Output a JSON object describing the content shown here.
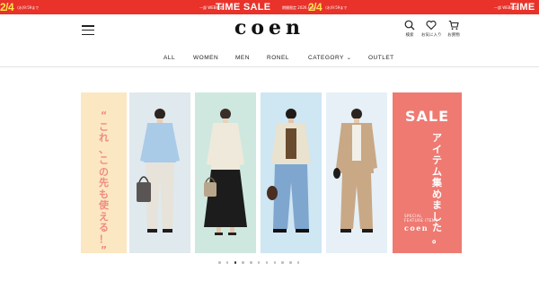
{
  "ticker": {
    "items": [
      {
        "date": "2/4",
        "small": "(水)9:59まで",
        "label": "",
        "small2": ""
      },
      {
        "date": "",
        "small": "",
        "label": "TIME SALE",
        "small2": "一部 WEB限定"
      },
      {
        "date": "",
        "small": "期間限定 2026.Feb.",
        "label": "",
        "small2": ""
      },
      {
        "date": "2/4",
        "small": "(水)9:59まで",
        "label": "",
        "small2": ""
      },
      {
        "date": "",
        "small": "",
        "label": "TIME",
        "small2": "一部 WEB限定"
      }
    ]
  },
  "header": {
    "logo": "coen",
    "icons": [
      {
        "name": "search-icon",
        "label": "検索"
      },
      {
        "name": "heart-icon",
        "label": "お気に入り"
      },
      {
        "name": "cart-icon",
        "label": "お買物"
      }
    ]
  },
  "nav": {
    "items": [
      "ALL",
      "WOMEN",
      "MEN",
      "RONEL",
      "CATEGORY",
      "OUTLET"
    ]
  },
  "banner": {
    "left_copy": [
      "“",
      "こ",
      "れ",
      "、",
      "こ",
      "の",
      "先",
      "も",
      "使",
      "え",
      "る",
      "！",
      "”"
    ],
    "sale_title": "SALE",
    "sale_copy": [
      "ア",
      "イ",
      "テ",
      "ム",
      "集",
      "め",
      "ま",
      "し",
      "た",
      "。"
    ],
    "feature_line1": "SPECIAL",
    "feature_line2": "FEATURE ITEMS",
    "sale_brand": "coen",
    "colors": {
      "left_bg": "#fbe7c2",
      "photo1_bg": "#dfe9ee",
      "photo2_bg": "#cfe8df",
      "photo3_bg": "#cfe6f3",
      "photo4_bg": "#e6f0f6",
      "sale_bg": "#ee7a72",
      "accent": "#e8322a"
    }
  },
  "carousel": {
    "total": 11,
    "active": 2
  }
}
